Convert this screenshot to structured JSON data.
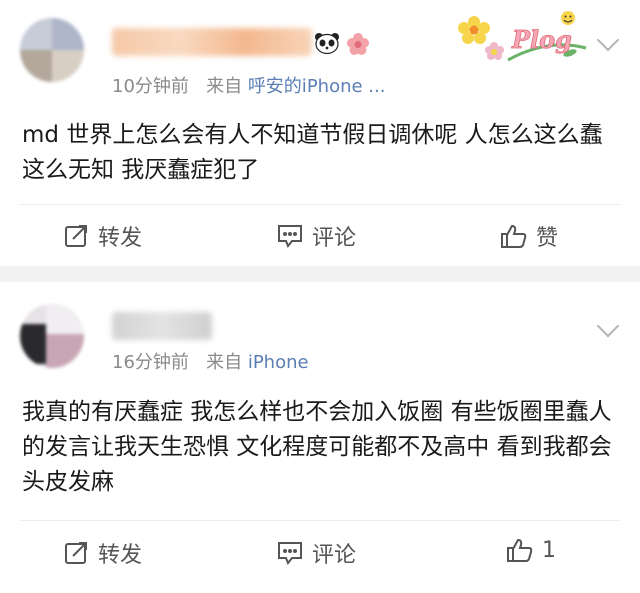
{
  "posts": [
    {
      "time": "10分钟前",
      "source_prefix": "来自",
      "source": "呼安的iPhone ...",
      "content": "md 世界上怎么会有人不知道节假日调休呢 人怎么这么蠢这么无知 我厌蠢症犯了",
      "decor_text": "Plog",
      "actions": {
        "repost": "转发",
        "comment": "评论",
        "like": "赞"
      }
    },
    {
      "time": "16分钟前",
      "source_prefix": "来自",
      "source": "iPhone",
      "content": "我真的有厌蠢症 我怎么样也不会加入饭圈 有些饭圈里蠢人的发言让我天生恐惧 文化程度可能都不及高中 看到我都会头皮发麻",
      "actions": {
        "repost": "转发",
        "comment": "评论",
        "like": "1"
      }
    }
  ],
  "colors": {
    "source_link": "#5b7fb4",
    "meta": "#8a8a8a",
    "separator": "#f2f2f2"
  }
}
